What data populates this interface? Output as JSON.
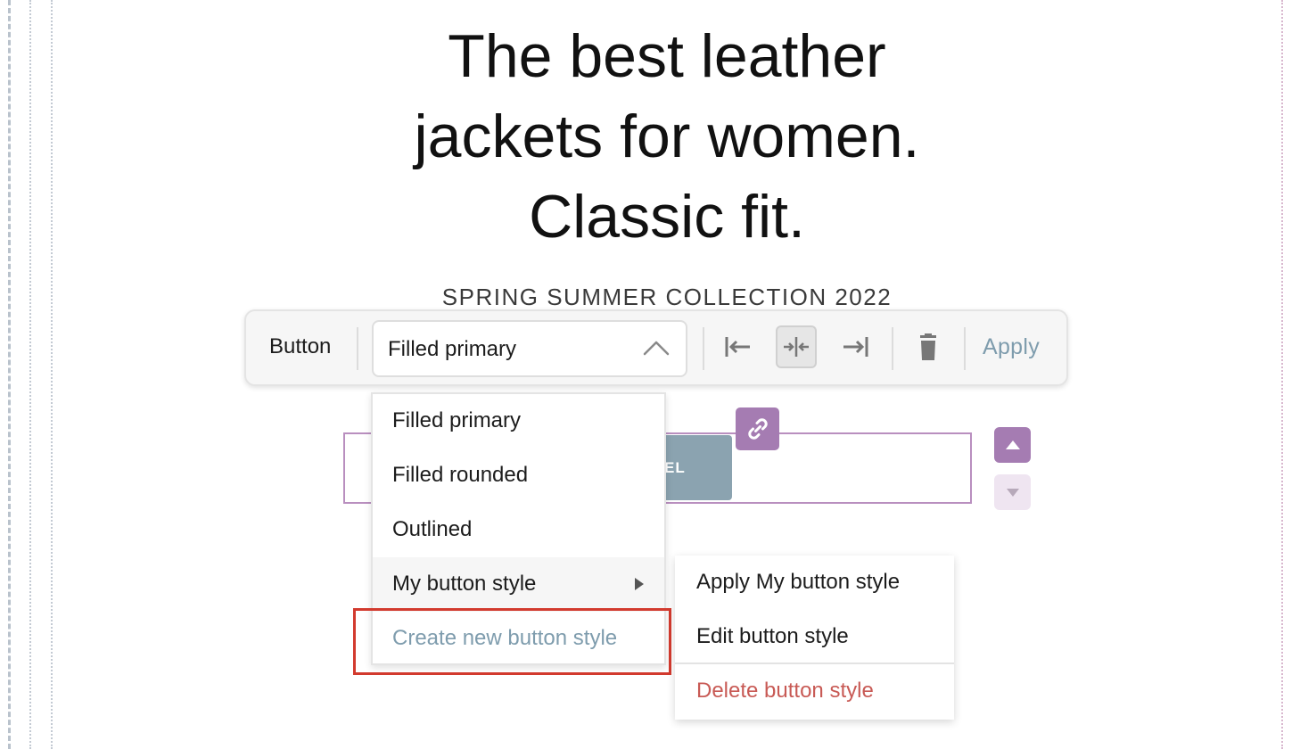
{
  "headline": {
    "line1": "The best leather",
    "line2": "jackets for women.",
    "line3": "Classic fit."
  },
  "subhead": "SPRING SUMMER COLLECTION 2022",
  "toolbar": {
    "element_label": "Button",
    "style_select": {
      "value": "Filled primary",
      "icon": "chevron-up-icon"
    },
    "align_buttons": [
      {
        "name": "align-left-icon"
      },
      {
        "name": "align-center-icon",
        "active": true
      },
      {
        "name": "align-right-icon"
      }
    ],
    "delete_icon": "trash-icon",
    "apply_label": "Apply",
    "accent_color": "#7e9cad"
  },
  "canvas": {
    "ghost_button_text": "EL",
    "link_icon": "link-icon",
    "move_up_icon": "triangle-up-icon",
    "move_down_icon": "triangle-down-icon",
    "selection_color": "#a57cb2"
  },
  "style_menu": {
    "items": [
      {
        "label": "Filled primary"
      },
      {
        "label": "Filled rounded"
      },
      {
        "label": "Outlined"
      },
      {
        "label": "My button style",
        "has_submenu": true
      },
      {
        "label": "Create new button style"
      }
    ]
  },
  "submenu": {
    "items": [
      {
        "label": "Apply My button style"
      },
      {
        "label": "Edit button style"
      },
      {
        "label": "Delete button style",
        "danger": true
      }
    ],
    "danger_color": "#c85a55"
  },
  "highlight_color": "#d23a2e"
}
